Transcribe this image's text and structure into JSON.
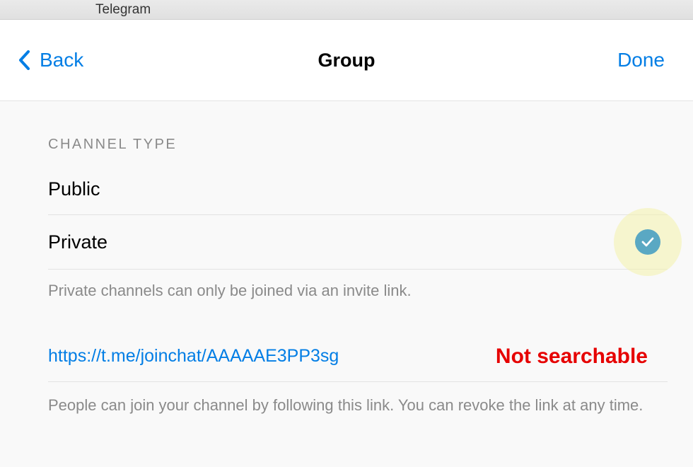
{
  "tab": {
    "title": "Telegram"
  },
  "nav": {
    "back_label": "Back",
    "title": "Group",
    "done_label": "Done"
  },
  "channel_type": {
    "header": "CHANNEL TYPE",
    "options": {
      "public": "Public",
      "private": "Private"
    },
    "selected": "private",
    "footer": "Private channels can only be joined via an invite link."
  },
  "invite": {
    "link": "https://t.me/joinchat/AAAAAE3PP3sg",
    "footer": "People can join your channel by following this link. You can revoke the link at any time."
  },
  "annotation": {
    "not_searchable": "Not searchable"
  },
  "colors": {
    "accent": "#037ee5",
    "check_bg": "#5aa8c3",
    "highlight": "#f4f3ab",
    "danger": "#e60000"
  }
}
